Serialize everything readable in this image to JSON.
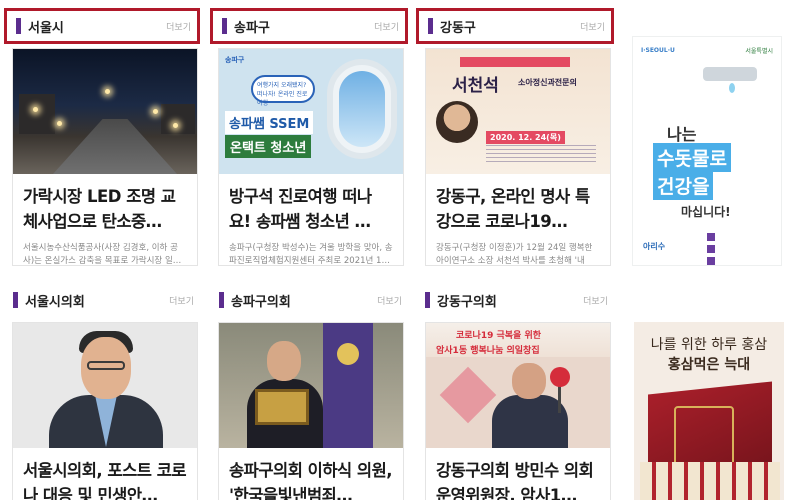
{
  "sections": [
    {
      "title": "서울시",
      "more": "더보기",
      "card": {
        "headline": "가락시장 LED 조명 교체사업으로 탄소중…",
        "summary": "서울시농수산식품공사(사장 김경호, 이하 공사)는 온실가스 감축을 목표로 가락시장 일…"
      }
    },
    {
      "title": "송파구",
      "more": "더보기",
      "card": {
        "headline": "방구석 진로여행 떠나요! 송파쌤 청소년 …",
        "summary": "송파구(구청장 박성수)는 겨울 방학을 맞아, 송파진로직업체험지원센터 주최로 2021년 1…",
        "thumb_text": {
          "logo": "송파구",
          "bubble": "여행가지 오래됐지? 떠나자! 온라인 진로여행",
          "banner1": "송파쌤 SSEM",
          "banner2": "온택트 청소년"
        }
      }
    },
    {
      "title": "강동구",
      "more": "더보기",
      "card": {
        "headline": "강동구, 온라인 명사 특강으로 코로나19…",
        "summary": "강동구(구청장 이정훈)가 12월 24일 행복한아이연구소 소장 서천석 박사를 초청해 '내 마…",
        "thumb_text": {
          "name": "서천석",
          "sub": "소아정신과전문의",
          "date": "2020. 12. 24(목)"
        }
      }
    },
    {
      "title": "서울시의회",
      "more": "더보기",
      "card": {
        "headline": "서울시의회, 포스트 코로나 대응 및 민생안…",
        "summary": ""
      }
    },
    {
      "title": "송파구의회",
      "more": "더보기",
      "card": {
        "headline": "송파구의회 이하식 의원, '한국을빛낸범죄…",
        "summary": ""
      }
    },
    {
      "title": "강동구의회",
      "more": "더보기",
      "card": {
        "headline": "강동구의회 방민수 의회운영위원장, 암사1…",
        "summary": "",
        "thumb_text": {
          "line1": "코로나19 극복을 위한",
          "line2": "암사1동 행복나눔 의일창집"
        }
      }
    }
  ],
  "ads": {
    "water": {
      "top": "I·SEOUL·U",
      "brand": "서울특별시",
      "line1": "나는",
      "line2": "수돗물로",
      "line3": "건강을",
      "line4": "마십니다!",
      "logo": "아리수"
    },
    "ginseng": {
      "line1": "나를 위한 하루 홍삼",
      "line2": "홍삼먹은 늑대"
    }
  },
  "colors": {
    "highlight_border": "#b0192a",
    "section_bar": "#5b2d8e"
  }
}
